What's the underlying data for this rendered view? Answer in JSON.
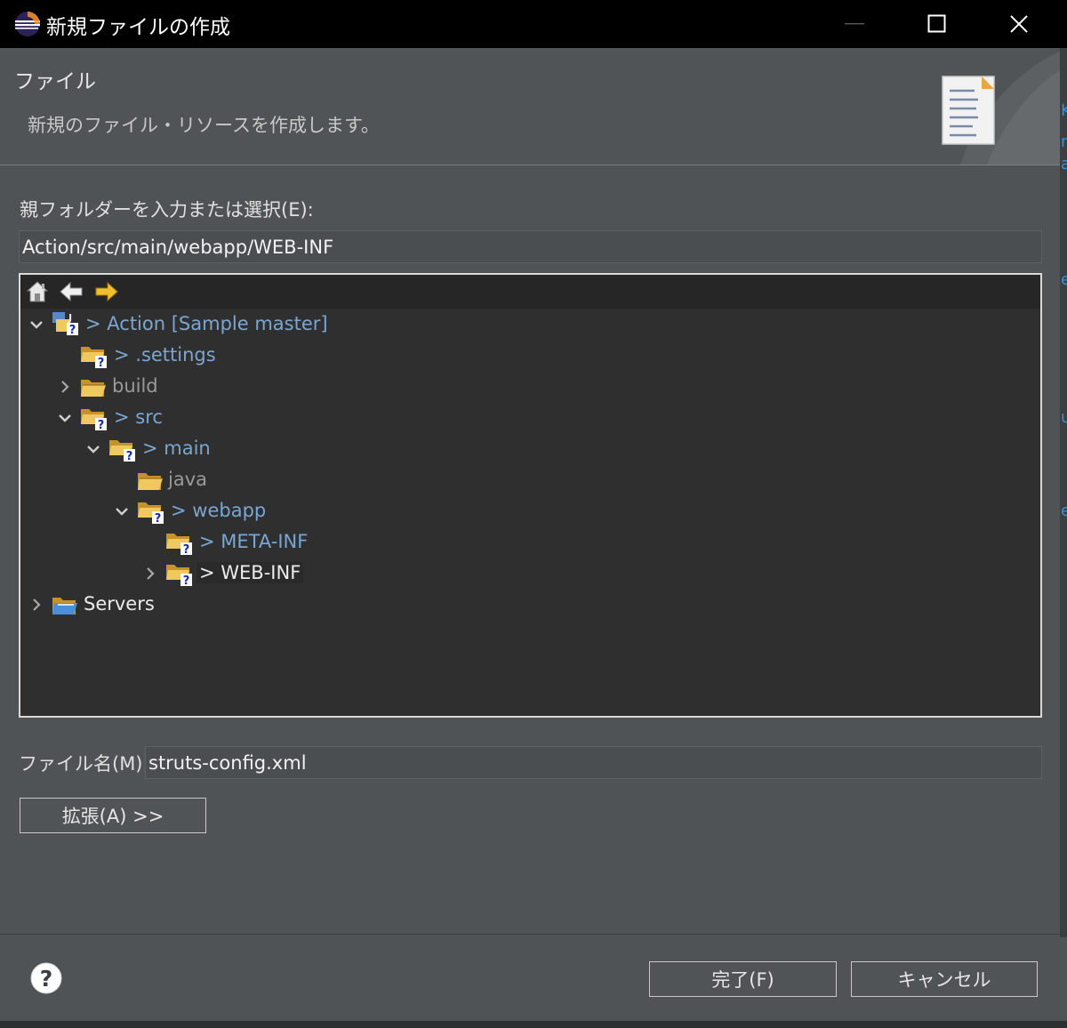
{
  "window": {
    "title": "新規ファイルの作成",
    "controls": [
      "minimize",
      "maximize",
      "close"
    ]
  },
  "header": {
    "title": "ファイル",
    "description": "新規のファイル・リソースを作成します。"
  },
  "folder": {
    "label": "親フォルダーを入力または選択(E):",
    "value": "Action/src/main/webapp/WEB-INF"
  },
  "tree": {
    "toolbar": [
      "home-icon",
      "back-arrow-icon",
      "forward-arrow-icon"
    ],
    "items": [
      {
        "label": "> Action [Sample master]",
        "expanded": true,
        "icon": "project-icon"
      },
      {
        "label": "> .settings",
        "icon": "folder-unknown-icon"
      },
      {
        "label": "build",
        "expanded": false,
        "icon": "folder-icon"
      },
      {
        "label": "> src",
        "expanded": true,
        "icon": "folder-unknown-icon"
      },
      {
        "label": "> main",
        "expanded": true,
        "icon": "folder-unknown-icon"
      },
      {
        "label": "java",
        "icon": "folder-icon"
      },
      {
        "label": "> webapp",
        "expanded": true,
        "icon": "folder-unknown-icon"
      },
      {
        "label": "> META-INF",
        "icon": "folder-unknown-icon"
      },
      {
        "label": "> WEB-INF",
        "expanded": false,
        "selected": true,
        "icon": "folder-unknown-icon"
      },
      {
        "label": "Servers",
        "expanded": false,
        "icon": "folder-open-blue-icon"
      }
    ]
  },
  "filename": {
    "label": "ファイル名(M):",
    "value": "struts-config.xml"
  },
  "buttons": {
    "advanced": "拡張(A) >>",
    "finish": "完了(F)",
    "cancel": "キャンセル"
  },
  "colors": {
    "background": "#4f5355",
    "tree_background": "#2f2f2f",
    "link_blue": "#7aa6d2",
    "title_bar": "#000000"
  }
}
